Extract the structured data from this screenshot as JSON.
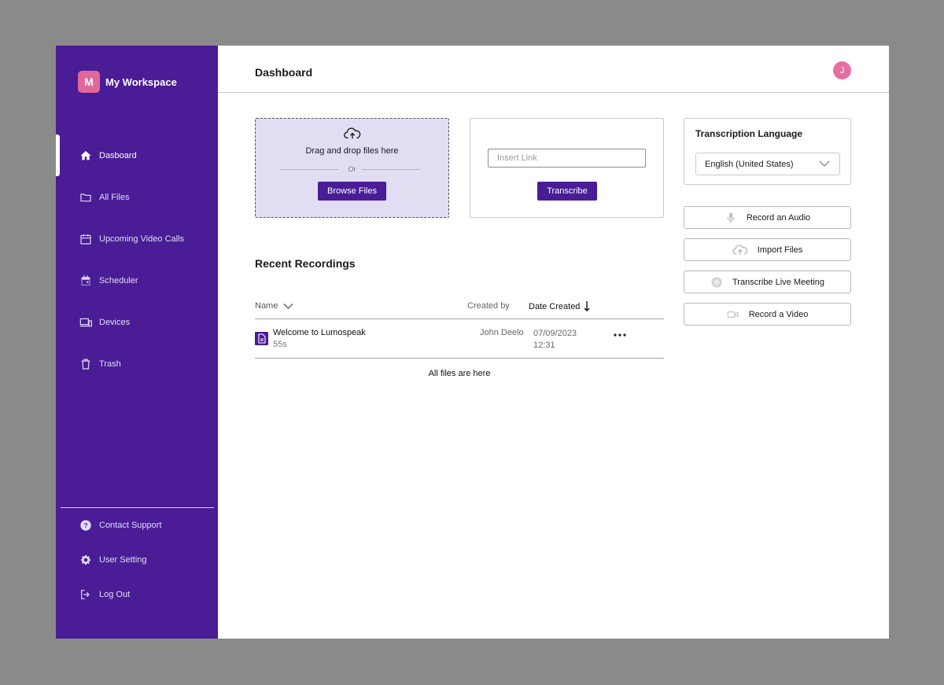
{
  "workspace": {
    "initial": "M",
    "name": "My Workspace"
  },
  "sidebar": {
    "items": [
      {
        "label": "Dasboard",
        "icon": "home-icon",
        "active": true
      },
      {
        "label": "All Files",
        "icon": "folder-icon"
      },
      {
        "label": "Upcoming Video Calls",
        "icon": "calendar-icon"
      },
      {
        "label": "Scheduler",
        "icon": "calendar-event-icon"
      },
      {
        "label": "Devices",
        "icon": "devices-icon"
      },
      {
        "label": "Trash",
        "icon": "trash-icon"
      }
    ],
    "bottom_items": [
      {
        "label": "Contact Support",
        "icon": "help-icon"
      },
      {
        "label": "User Setting",
        "icon": "gear-icon"
      },
      {
        "label": "Log Out",
        "icon": "logout-icon"
      }
    ]
  },
  "header": {
    "title": "Dashboard",
    "user_initial": "J"
  },
  "upload": {
    "drag_text": "Drag and drop files here",
    "or_text": "Or",
    "browse_label": "Browse Files"
  },
  "link": {
    "placeholder": "Insert Link",
    "transcribe_label": "Transcribe"
  },
  "language": {
    "title": "Transcription Language",
    "selected": "English (United States)"
  },
  "actions": [
    {
      "label": "Record an Audio",
      "icon": "microphone-icon"
    },
    {
      "label": "Import Files",
      "icon": "cloud-upload-icon"
    },
    {
      "label": "Transcribe Live Meeting",
      "icon": "live-meeting-icon"
    },
    {
      "label": "Record a Video",
      "icon": "video-camera-icon"
    }
  ],
  "recent": {
    "title": "Recent Recordings",
    "columns": {
      "name": "Name",
      "created_by": "Created by",
      "date_created": "Date Created"
    },
    "rows": [
      {
        "name": "Welcome to Lumospeak",
        "duration": "55s",
        "created_by": "John Deelo",
        "date": "07/09/2023",
        "time": "12:31"
      }
    ],
    "footer": "All files are here"
  },
  "colors": {
    "brand": "#4a1c96",
    "accent": "#e2689b",
    "dropzone_bg": "#e1ddf3"
  }
}
